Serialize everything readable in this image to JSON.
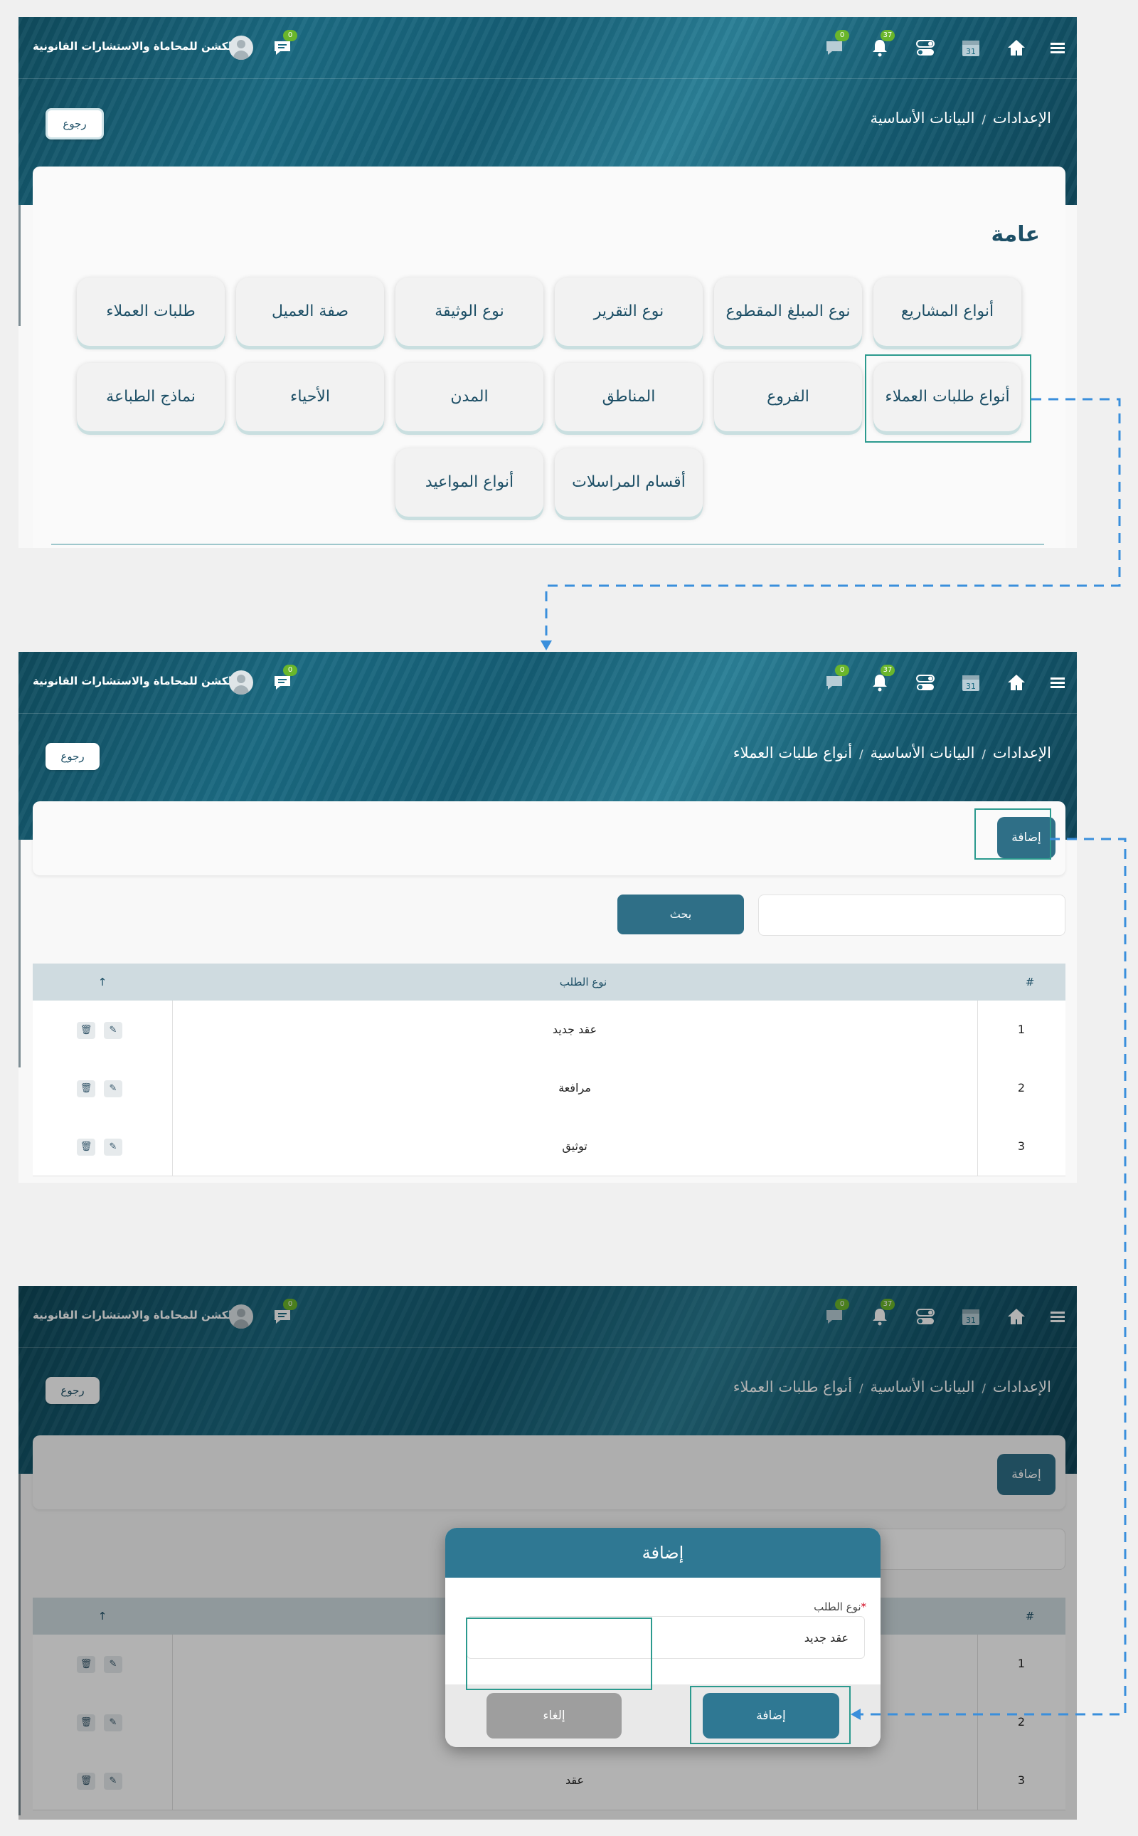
{
  "app": {
    "company_name": "الكشن للمحاماة والاستشارات القانونية"
  },
  "topbar": {
    "chat_badge": "0",
    "messages_badge": "0",
    "notifications_badge": "37",
    "calendar_day": "31",
    "menu_icon": "hamburger-icon",
    "home_icon": "home-icon",
    "toggle_icon": "toggle-icon"
  },
  "screen1": {
    "breadcrumb": [
      "الإعدادات",
      "البيانات الأساسية"
    ],
    "back_label": "رجوع",
    "section_title": "عامة",
    "tiles_row1": [
      "أنواع المشاريع",
      "نوع المبلغ المقطوع",
      "نوع التقرير",
      "نوع الوثيقة",
      "صفة العميل",
      "طلبات العملاء"
    ],
    "tiles_row2": [
      "أنواع طلبات العملاء",
      "الفروع",
      "المناطق",
      "المدن",
      "الأحياء",
      "نماذج الطباعة"
    ],
    "tiles_row3": [
      "أقسام المراسلات",
      "أنواع المواعيد"
    ]
  },
  "screen2": {
    "breadcrumb": [
      "الإعدادات",
      "البيانات الأساسية",
      "أنواع طلبات العملاء"
    ],
    "back_label": "رجوع",
    "add_label": "إضافة",
    "search_label": "بحث",
    "table": {
      "headers": {
        "index": "#",
        "type": "نوع الطلب",
        "sort_icon": "↑"
      },
      "rows": [
        {
          "index": "1",
          "type": "عقد جديد"
        },
        {
          "index": "2",
          "type": "مرافعة"
        },
        {
          "index": "3",
          "type": "توثيق"
        }
      ]
    }
  },
  "screen3": {
    "breadcrumb": [
      "الإعدادات",
      "البيانات الأساسية",
      "أنواع طلبات العملاء"
    ],
    "back_label": "رجوع",
    "add_label": "إضافة",
    "table": {
      "headers": {
        "index": "#",
        "sort_icon": "↑"
      },
      "rows": [
        {
          "index": "1",
          "type": ""
        },
        {
          "index": "2",
          "type": ""
        },
        {
          "index": "3",
          "type": "عقد"
        }
      ]
    },
    "modal": {
      "title": "إضافة",
      "field_label": "نوع الطلب",
      "required_mark": "*",
      "field_value": "عقد جديد",
      "submit_label": "إضافة",
      "cancel_label": "إلغاء"
    }
  },
  "colors": {
    "primary": "#2f6f87",
    "badge": "#6ab62b",
    "highlight": "#2b9a8e",
    "connector": "#3a8fdc"
  }
}
